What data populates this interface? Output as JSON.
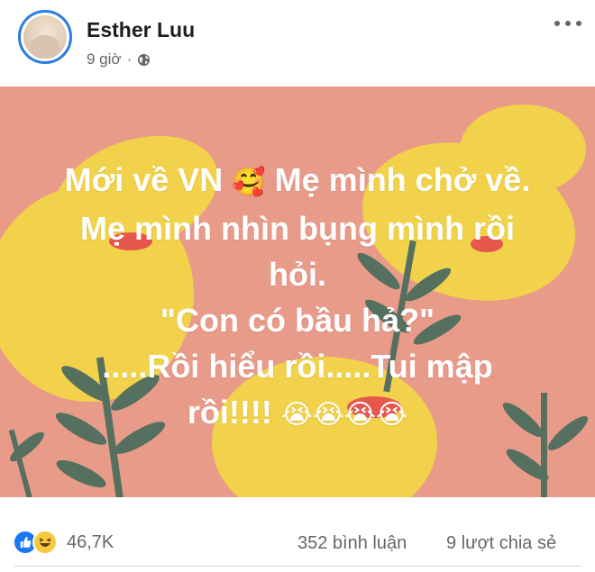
{
  "author": {
    "name": "Esther Luu"
  },
  "post": {
    "time": "9 giờ",
    "separator": "·",
    "caption_lines": [
      "Mới về VN",
      "Mẹ mình chở về.",
      "Mẹ mình nhìn bụng mình rồi",
      "hỏi.",
      "\"Con có bầu hả?\"",
      ".....Rồi hiểu rồi.....Tui mập",
      "rồi!!!!"
    ],
    "emoji_heart": "🥰",
    "emoji_cry": "😭😭😭😭"
  },
  "engagement": {
    "reaction_count": "46,7K",
    "comments": "352 bình luận",
    "shares": "9 lượt chia sẻ"
  },
  "colors": {
    "image_bg": "#e99b8a",
    "flower_yellow": "#f1d24a",
    "leaf_green": "#55705e",
    "like_blue": "#1877f2"
  }
}
